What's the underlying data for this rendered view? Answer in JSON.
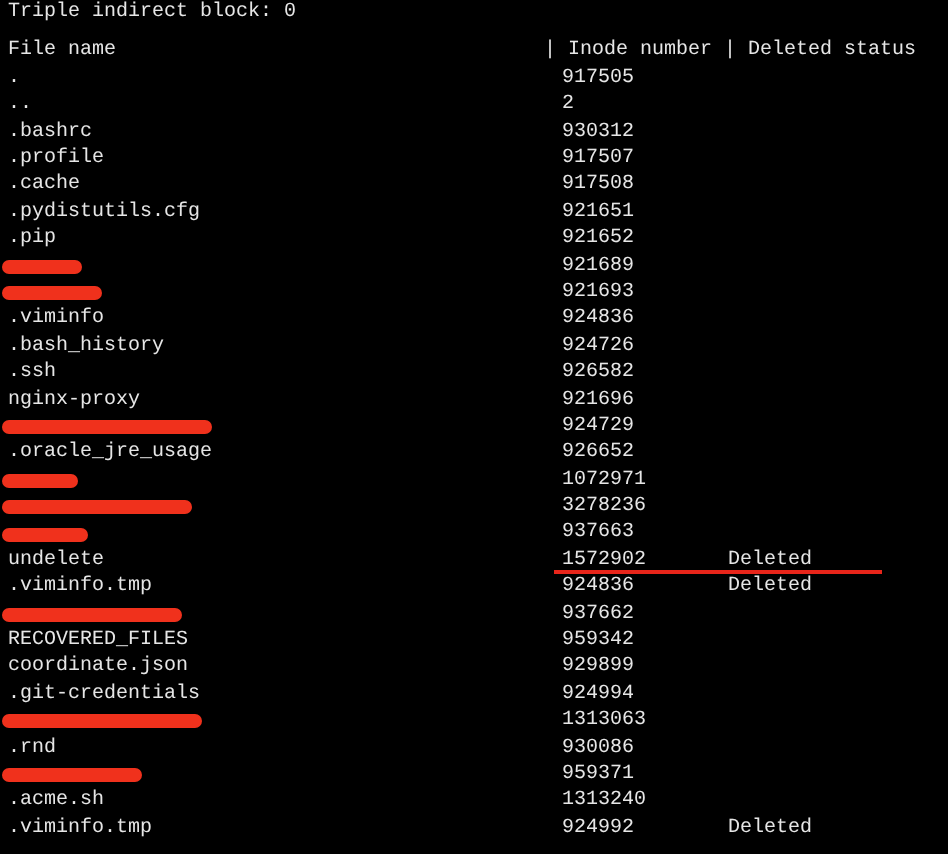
{
  "top_line": "Triple indirect block: 0",
  "header": {
    "file_name": "File name",
    "columns": "| Inode number | Deleted status"
  },
  "rows": [
    {
      "name": ".",
      "inode": "917505",
      "redacted": false,
      "underlined": false
    },
    {
      "name": "..",
      "inode": "2",
      "redacted": false,
      "underlined": false
    },
    {
      "name": ".bashrc",
      "inode": "930312",
      "redacted": false,
      "underlined": false
    },
    {
      "name": ".profile",
      "inode": "917507",
      "redacted": false,
      "underlined": false
    },
    {
      "name": ".cache",
      "inode": "917508",
      "redacted": false,
      "underlined": false
    },
    {
      "name": ".pydistutils.cfg",
      "inode": "921651",
      "redacted": false,
      "underlined": false
    },
    {
      "name": ".pip",
      "inode": "921652",
      "redacted": false,
      "underlined": false
    },
    {
      "inode": "921689",
      "redacted": true,
      "underlined": false
    },
    {
      "inode": "921693",
      "redacted": true,
      "underlined": false
    },
    {
      "name": ".viminfo",
      "inode": "924836",
      "redacted": false,
      "underlined": false
    },
    {
      "name": ".bash_history",
      "inode": "924726",
      "redacted": false,
      "underlined": false
    },
    {
      "name": ".ssh",
      "inode": "926582",
      "redacted": false,
      "underlined": false
    },
    {
      "name": "nginx-proxy",
      "inode": "921696",
      "redacted": false,
      "underlined": false
    },
    {
      "inode": "924729",
      "redacted": true,
      "underlined": false
    },
    {
      "name": ".oracle_jre_usage",
      "inode": "926652",
      "redacted": false,
      "underlined": false
    },
    {
      "inode": "1072971",
      "redacted": true,
      "underlined": false
    },
    {
      "inode": "3278236",
      "redacted": true,
      "underlined": false
    },
    {
      "inode": "937663",
      "redacted": true,
      "underlined": false
    },
    {
      "name": "undelete",
      "inode": "1572902",
      "status": "Deleted",
      "redacted": false,
      "underlined": true
    },
    {
      "name": ".viminfo.tmp",
      "inode": "924836",
      "status": "Deleted",
      "redacted": false,
      "underlined": false
    },
    {
      "inode": "937662",
      "redacted": true,
      "underlined": false
    },
    {
      "name": "RECOVERED_FILES",
      "inode": "959342",
      "redacted": false,
      "underlined": false
    },
    {
      "name": "coordinate.json",
      "inode": "929899",
      "redacted": false,
      "underlined": false
    },
    {
      "name": ".git-credentials",
      "inode": "924994",
      "redacted": false,
      "underlined": false
    },
    {
      "inode": "1313063",
      "redacted": true,
      "underlined": false
    },
    {
      "name": ".rnd",
      "inode": "930086",
      "redacted": false,
      "underlined": false
    },
    {
      "inode": "959371",
      "redacted": true,
      "underlined": false
    },
    {
      "name": ".acme.sh",
      "inode": "1313240",
      "redacted": false,
      "underlined": false
    },
    {
      "name": ".viminfo.tmp",
      "inode": "924992",
      "status": "Deleted",
      "redacted": false,
      "underlined": false
    }
  ]
}
